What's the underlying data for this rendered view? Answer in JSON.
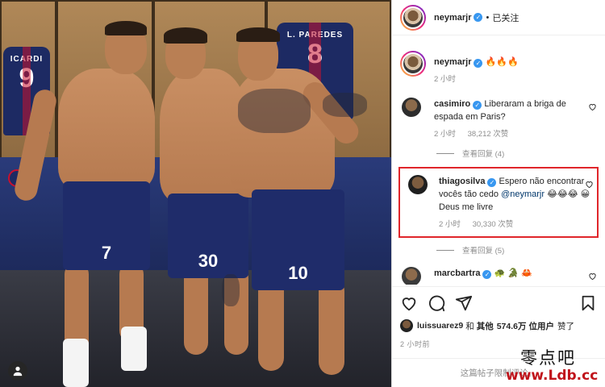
{
  "photo": {
    "jerseys": [
      {
        "name": "ICARDI",
        "number": "9"
      },
      {
        "name": "L. PAREDES",
        "number": "8"
      }
    ],
    "shorts_numbers": [
      "7",
      "30",
      "10"
    ]
  },
  "post": {
    "author": "neymarjr",
    "follow_status": "已关注",
    "caption_emojis": "🔥🔥🔥",
    "caption_time": "2 小时",
    "likes": {
      "first_user": "luissuarez9",
      "and": "和",
      "others_label": "其他",
      "count": "574.6万",
      "unit_suffix": "位用户",
      "liked": "赞了"
    },
    "posted_time": "2 小时前",
    "comment_placeholder": "这篇帖子限制评论。"
  },
  "comments": [
    {
      "user": "casimiro",
      "text": "Liberaram a briga de espada em Paris?",
      "time": "2 小时",
      "likes": "38,212 次赞",
      "replies": "查看回复 (4)"
    },
    {
      "user": "thiagosilva",
      "text_a": "Espero não encontrar vocês tão cedo",
      "mention": "@neymarjr",
      "emojis_a": "😂😂😂",
      "text_b": "Deus me livre",
      "emojis_b": "😀",
      "time": "2 小时",
      "likes": "30,330 次赞",
      "replies": "查看回复 (5)"
    },
    {
      "user": "marcbartra",
      "emojis": "🐢 🐊 🦀"
    }
  ],
  "watermark": {
    "cn": "零点吧",
    "url": "www.Ldb.cc"
  },
  "colors": {
    "verified": "#3897f0",
    "highlight_border": "#e0262b",
    "watermark_url": "#c0141b",
    "psg_navy": "#1d2a63"
  }
}
